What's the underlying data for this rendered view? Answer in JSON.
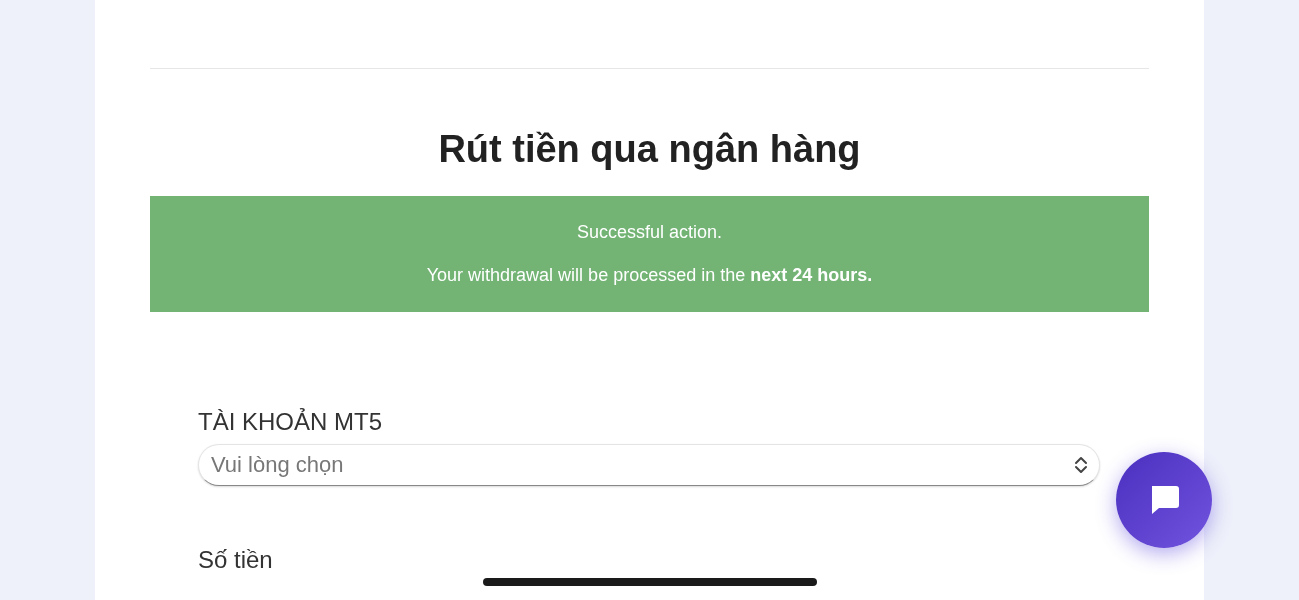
{
  "title": "Rút tiền qua ngân hàng",
  "alert": {
    "kind": "success",
    "lines": [
      "Successful action.",
      "Your withdrawal will be processed in the **next 24 hours.**"
    ]
  },
  "fields": [
    {
      "kind": "select",
      "label": "TÀI KHOẢN MT5",
      "placeholder": "Vui lòng chọn"
    },
    {
      "kind": "text",
      "label": "Số tiền"
    }
  ]
}
